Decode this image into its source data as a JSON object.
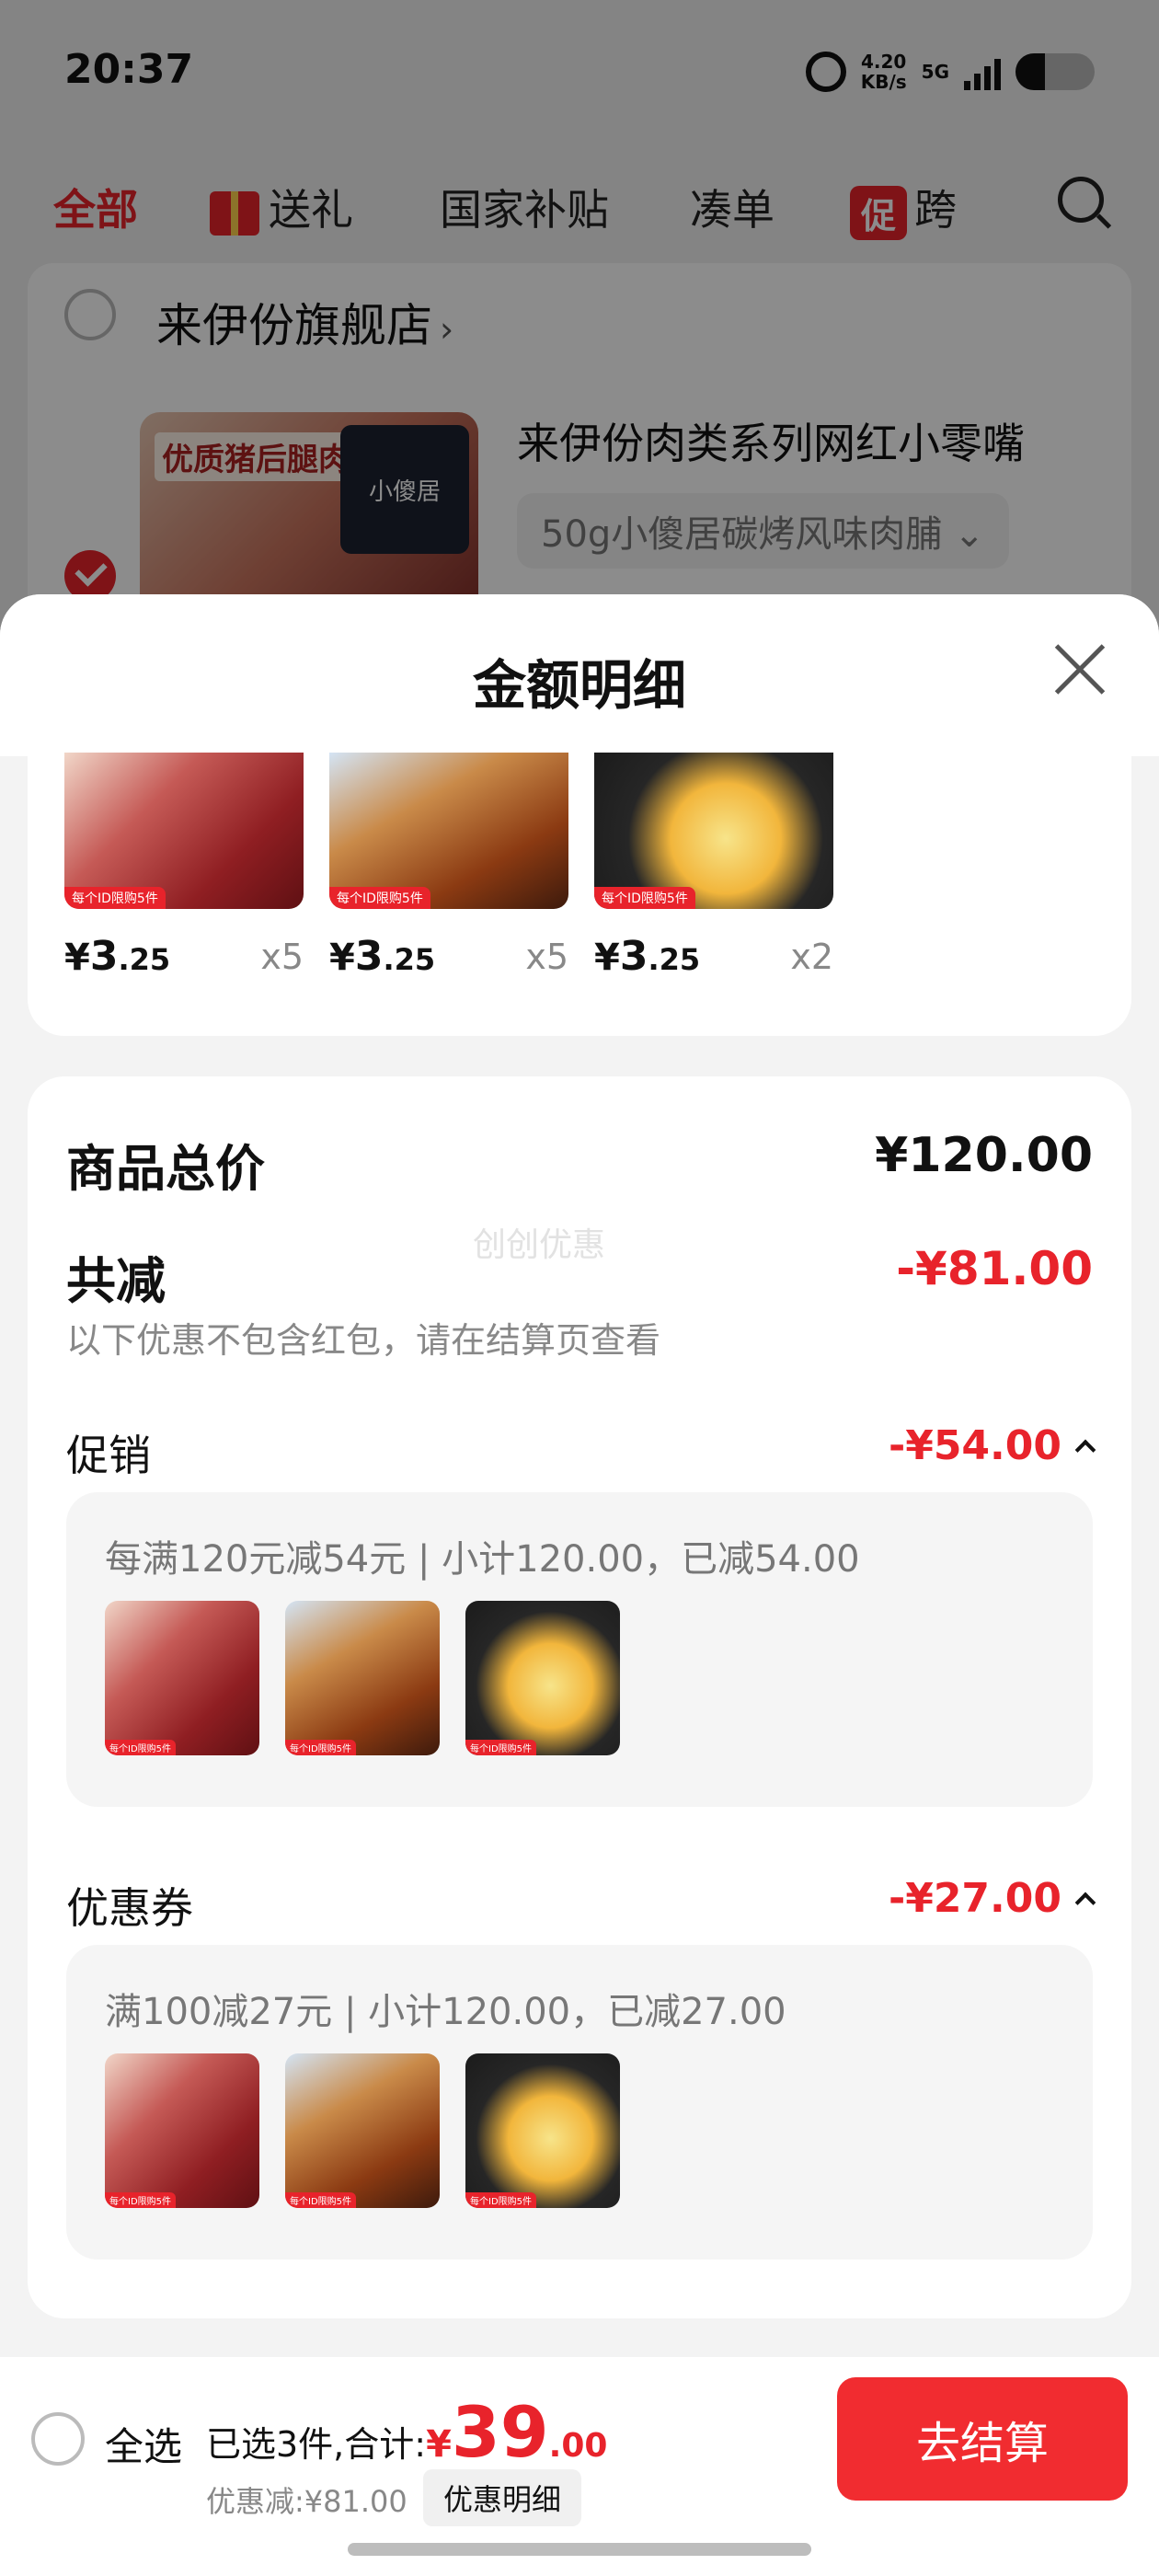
{
  "status_bar": {
    "time": "20:37",
    "net_speed": "4.20",
    "net_unit": "KB/s",
    "network": "5G"
  },
  "tabs": [
    {
      "label": "全部"
    },
    {
      "label": "送礼"
    },
    {
      "label": "国家补贴"
    },
    {
      "label": "凑单"
    },
    {
      "badge": "促",
      "label": "跨"
    }
  ],
  "store": {
    "name": "来伊份旗舰店",
    "chevron": "›",
    "product_title": "来伊份肉类系列网红小零嘴",
    "sku": "50g小傻居碳烤风味肉脯 ⌄",
    "image_label": "优质猪后腿肉",
    "image_brand": "小傻居"
  },
  "sheet": {
    "title": "金额明细",
    "items": [
      {
        "currency": "¥",
        "int": "3",
        "dec": ".25",
        "qty": "x5",
        "tag": "每个ID限购5件"
      },
      {
        "currency": "¥",
        "int": "3",
        "dec": ".25",
        "qty": "x5",
        "tag": "每个ID限购5件"
      },
      {
        "currency": "¥",
        "int": "3",
        "dec": ".25",
        "qty": "x2",
        "tag": "每个ID限购5件"
      }
    ],
    "total_label": "商品总价",
    "total_value": "¥120.00",
    "watermark": "创创优惠",
    "reduce_label": "共减",
    "reduce_value": "-¥81.00",
    "reduce_note": "以下优惠不包含红包，请在结算页查看",
    "promo": {
      "label": "促销",
      "value": "-¥54.00",
      "desc": "每满120元减54元 | 小计120.00，已减54.00"
    },
    "coupon": {
      "label": "优惠券",
      "value": "-¥27.00",
      "desc": "满100减27元 | 小计120.00，已减27.00"
    },
    "thumb_tag": "每个ID限购5件"
  },
  "bottom": {
    "select_all": "全选",
    "selected_text": "已选3件,合计:",
    "currency": "¥",
    "amount_int": "39",
    "amount_dec": ".00",
    "discount_line": "优惠减:¥81.00",
    "detail_chip": "优惠明细",
    "checkout": "去结算"
  },
  "colors": {
    "accent": "#e8232b",
    "checkout_button": "#f12c30"
  }
}
